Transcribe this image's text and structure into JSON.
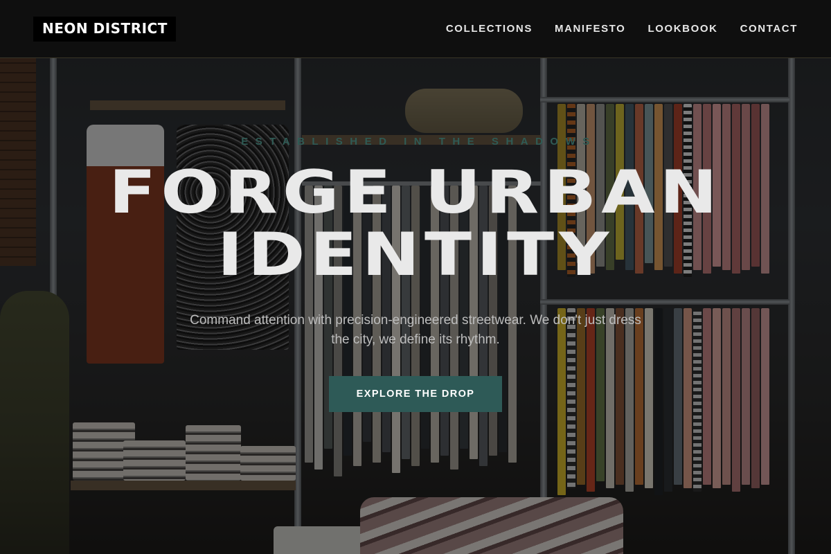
{
  "header": {
    "logo": "NEON DISTRICT",
    "nav": [
      {
        "label": "COLLECTIONS"
      },
      {
        "label": "MANIFESTO"
      },
      {
        "label": "LOOKBOOK"
      },
      {
        "label": "CONTACT"
      }
    ]
  },
  "hero": {
    "eyebrow": "ESTABLISHED IN THE SHADOWS",
    "headline_line1": "FORGE URBAN",
    "headline_line2": "IDENTITY",
    "subtext": "Command attention with precision-engineered streetwear. We don't just dress the city, we define its rhythm.",
    "cta_label": "EXPLORE THE DROP"
  },
  "colors": {
    "accent": "#2e5a57",
    "header_bg": "#0e0e0e",
    "headline": "#e9e9e9",
    "eyebrow": "#2f5b55"
  }
}
